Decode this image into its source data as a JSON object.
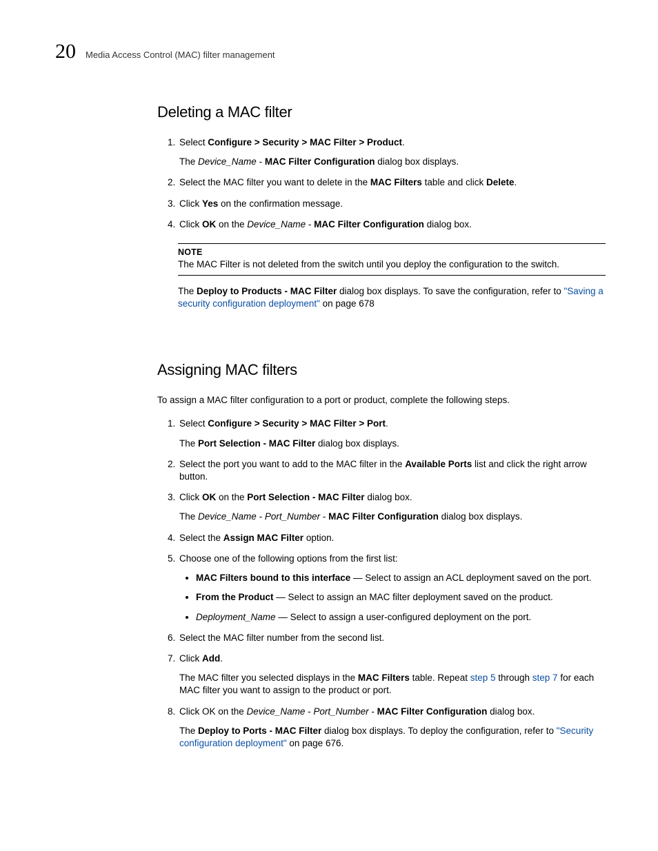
{
  "header": {
    "chapter_number": "20",
    "breadcrumb": "Media Access Control (MAC) filter management"
  },
  "section1": {
    "title": "Deleting a MAC filter",
    "steps": [
      {
        "pre": "Select ",
        "bold": "Configure > Security > MAC Filter > Product",
        "post": ".",
        "sub_pre": "The ",
        "sub_i": "Device_Name",
        "sub_mid": " - ",
        "sub_b": "MAC Filter Configuration",
        "sub_post": " dialog box displays."
      },
      {
        "pre": "Select the MAC filter you want to delete in the ",
        "bold": "MAC Filters",
        "mid": " table and click ",
        "bold2": "Delete",
        "post": "."
      },
      {
        "pre": "Click ",
        "bold": "Yes",
        "post": " on the confirmation message."
      },
      {
        "pre": "Click ",
        "bold": "OK",
        "mid": " on the ",
        "i": "Device_Name",
        "mid2": " - ",
        "bold2": "MAC Filter Configuration",
        "post": " dialog box."
      }
    ],
    "note_label": "NOTE",
    "note_body": "The MAC Filter is not deleted from the switch until you deploy the configuration to the switch.",
    "after_note_pre": "The ",
    "after_note_b": "Deploy to Products - MAC Filter",
    "after_note_mid": " dialog box displays. To save the configuration, refer to ",
    "after_note_link": "\"Saving a security configuration deployment\"",
    "after_note_post": " on page 678"
  },
  "section2": {
    "title": "Assigning MAC filters",
    "intro": "To assign a MAC filter configuration to a port or product, complete the following steps.",
    "step1": {
      "pre": "Select ",
      "bold": "Configure > Security > MAC Filter > Port",
      "post": ".",
      "sub_pre": "The ",
      "sub_b": "Port Selection - MAC Filter",
      "sub_post": " dialog box displays."
    },
    "step2": {
      "pre": "Select the port you want to add to the MAC filter in the ",
      "bold": "Available Ports",
      "post": " list and click the right arrow button."
    },
    "step3": {
      "pre": "Click ",
      "bold": "OK",
      "mid": " on the ",
      "bold2": "Port Selection - MAC Filter",
      "post": " dialog box.",
      "sub_pre": "The ",
      "sub_i1": "Device_Name",
      "sub_sep1": " - ",
      "sub_i2": "Port_Number",
      "sub_sep2": " - ",
      "sub_b": "MAC Filter Configuration",
      "sub_post": " dialog box displays."
    },
    "step4": {
      "pre": "Select the ",
      "bold": "Assign MAC Filter",
      "post": " option."
    },
    "step5": {
      "text": "Choose one of the following options from the first list:",
      "b1_b": "MAC Filters bound to this interface",
      "b1_post": " — Select to assign an ACL deployment saved on the port.",
      "b2_b": "From the Product",
      "b2_post": " — Select to assign an MAC filter deployment saved on the product.",
      "b3_i": "Deployment_Name",
      "b3_post": " — Select to assign a user-configured deployment on the port."
    },
    "step6": {
      "text": "Select the MAC filter number from the second list."
    },
    "step7": {
      "pre": "Click ",
      "bold": "Add",
      "post": ".",
      "sub_pre": "The MAC filter you selected displays in the ",
      "sub_b": "MAC Filters",
      "sub_mid": " table. Repeat ",
      "sub_link1": "step 5",
      "sub_mid2": " through ",
      "sub_link2": "step 7",
      "sub_post": " for each MAC filter you want to assign to the product or port."
    },
    "step8": {
      "pre": "Click OK on the ",
      "i1": "Device_Name",
      "sep1": " - ",
      "i2": "Port_Number",
      "sep2": " - ",
      "bold": "MAC Filter Configuration",
      "post": " dialog box.",
      "sub_pre": "The ",
      "sub_b": "Deploy to Ports - MAC Filter",
      "sub_mid": " dialog box displays. To deploy the configuration, refer to ",
      "sub_link": "\"Security configuration deployment\"",
      "sub_post": " on page 676."
    }
  }
}
